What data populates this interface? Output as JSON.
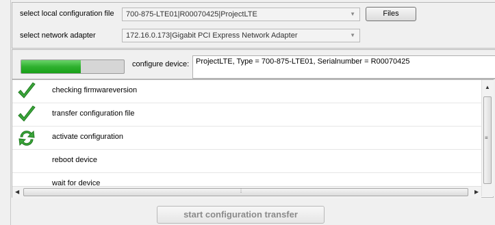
{
  "config": {
    "file_label": "select local configuration file",
    "file_value": "700-875-LTE01|R00070425|ProjectLTE",
    "adapter_label": "select network adapter",
    "adapter_value": "172.16.0.173|Gigabit PCI Express Network Adapter",
    "files_button": "Files"
  },
  "status": {
    "progress_fraction": 0.58,
    "configure_label": "configure device:",
    "device_info": "ProjectLTE, Type = 700-875-LTE01, Serialnumber = R00070425"
  },
  "steps": [
    {
      "label": "checking firmwareversion",
      "state": "done",
      "icon": "checkmark-icon"
    },
    {
      "label": "transfer configuration file",
      "state": "done",
      "icon": "checkmark-icon"
    },
    {
      "label": "activate configuration",
      "state": "in-progress",
      "icon": "refresh-icon"
    },
    {
      "label": "reboot device",
      "state": "pending",
      "icon": ""
    },
    {
      "label": "wait for device",
      "state": "pending",
      "icon": ""
    }
  ],
  "start_button": "start configuration transfer",
  "colors": {
    "progress_green": "#2fb12f",
    "check_green": "#3aa53a"
  }
}
